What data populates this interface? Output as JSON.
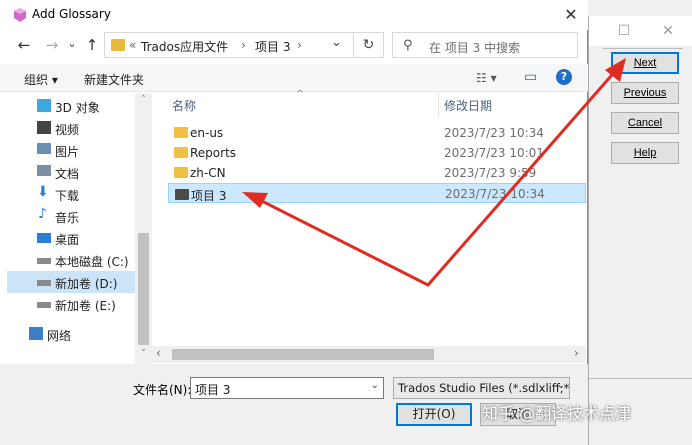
{
  "dialog": {
    "title": "Add Glossary",
    "close_glyph": "✕"
  },
  "nav": {
    "back_glyph": "←",
    "forward_glyph": "→",
    "recent_glyph": "⌄",
    "up_glyph": "↑"
  },
  "address": {
    "prefix": "«",
    "crumb1": "Trados应用文件",
    "sep": "›",
    "crumb2": "项目 3",
    "sep2": "›",
    "dropdown_glyph": "⌄",
    "refresh_glyph": "↻"
  },
  "search": {
    "icon_glyph": "⚲",
    "placeholder": "在 项目 3 中搜索"
  },
  "commands": {
    "organize": "组织 ▾",
    "new_folder": "新建文件夹",
    "view_glyph": "☷ ▾",
    "pane_glyph": "▭",
    "help_glyph": "?"
  },
  "navpane": {
    "items": [
      {
        "label": "3D 对象",
        "icon": "cube-icon",
        "color": "#3fa7e0"
      },
      {
        "label": "视频",
        "icon": "video-icon",
        "color": "#444444"
      },
      {
        "label": "图片",
        "icon": "pictures-icon",
        "color": "#6a8fb3"
      },
      {
        "label": "文档",
        "icon": "documents-icon",
        "color": "#7a8fa3"
      },
      {
        "label": "下载",
        "icon": "downloads-icon",
        "color": "#2a7fd4"
      },
      {
        "label": "音乐",
        "icon": "music-icon",
        "color": "#2a7fd4"
      },
      {
        "label": "桌面",
        "icon": "desktop-icon",
        "color": "#2a7fd4"
      },
      {
        "label": "本地磁盘 (C:)",
        "icon": "drive-icon",
        "color": "#777777"
      },
      {
        "label": "新加卷 (D:)",
        "icon": "drive-icon",
        "color": "#777777"
      },
      {
        "label": "新加卷 (E:)",
        "icon": "drive-icon",
        "color": "#777777"
      },
      {
        "label": "网络",
        "icon": "network-icon",
        "color": "#3d7fc4"
      }
    ]
  },
  "list": {
    "col_name": "名称",
    "col_date": "修改日期",
    "sort_glyph": "^",
    "rows": [
      {
        "name": "en-us",
        "date": "2023/7/23 10:34"
      },
      {
        "name": "Reports",
        "date": "2023/7/23 10:01"
      },
      {
        "name": "zh-CN",
        "date": "2023/7/23 9:59"
      },
      {
        "name": "项目 3",
        "date": "2023/7/23 10:34"
      }
    ],
    "scroll_left": "‹",
    "scroll_right": "›",
    "scroll_up": "˄",
    "scroll_down": "˅"
  },
  "bottom": {
    "filename_label": "文件名(N):",
    "filename_value": "项目 3",
    "filetype_value": "Trados Studio Files (*.sdlxliff;*",
    "dropdown_glyph": "⌄",
    "open_label": "打开(O)",
    "cancel_label": "取消",
    "watermark": "知乎 @翻译技术点津"
  },
  "wizard": {
    "min_glyph": "☐",
    "close_glyph": "✕",
    "next_label": "Next",
    "previous_label": "Previous",
    "cancel_label": "Cancel",
    "help_label": "Help"
  },
  "annotation_color": "#e02b20"
}
